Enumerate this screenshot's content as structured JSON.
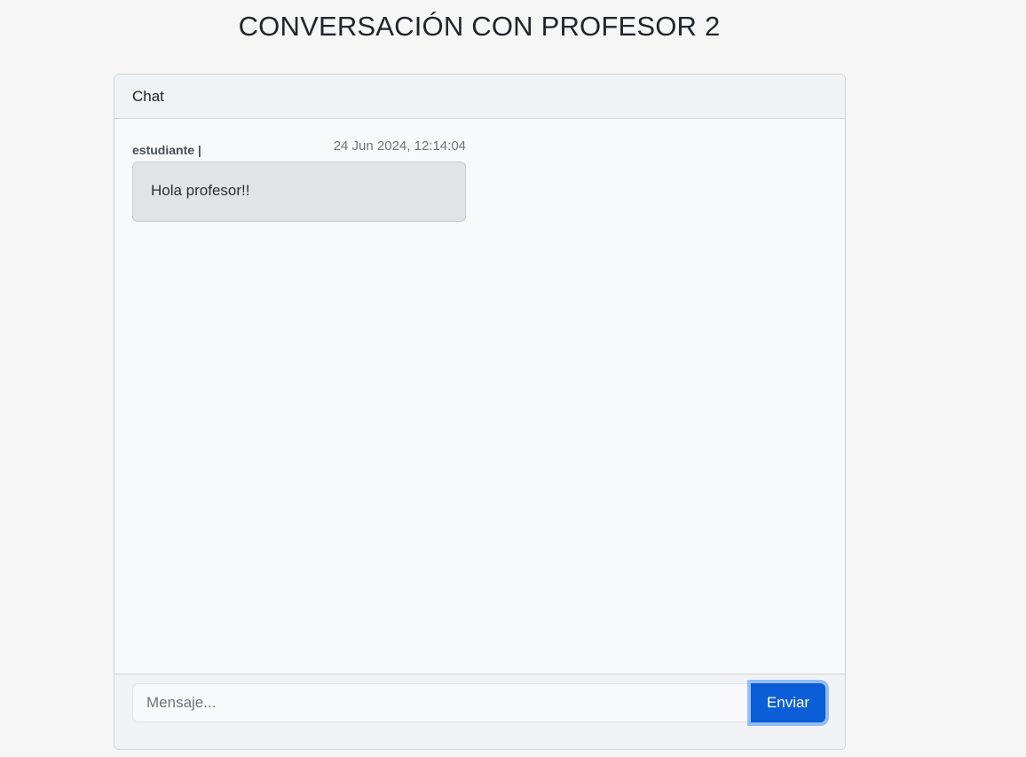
{
  "page": {
    "title": "CONVERSACIÓN CON PROFESOR 2"
  },
  "chat": {
    "header": "Chat",
    "messages": [
      {
        "sender": "estudiante |",
        "timestamp": "24 Jun 2024, 12:14:04",
        "text": "Hola profesor!!"
      }
    ]
  },
  "composer": {
    "placeholder": "Mensaje...",
    "value": "",
    "send_label": "Enviar"
  },
  "colors": {
    "accent": "#0b5ed7",
    "bubble": "#e2e3e5",
    "background": "#f6f6f7"
  }
}
